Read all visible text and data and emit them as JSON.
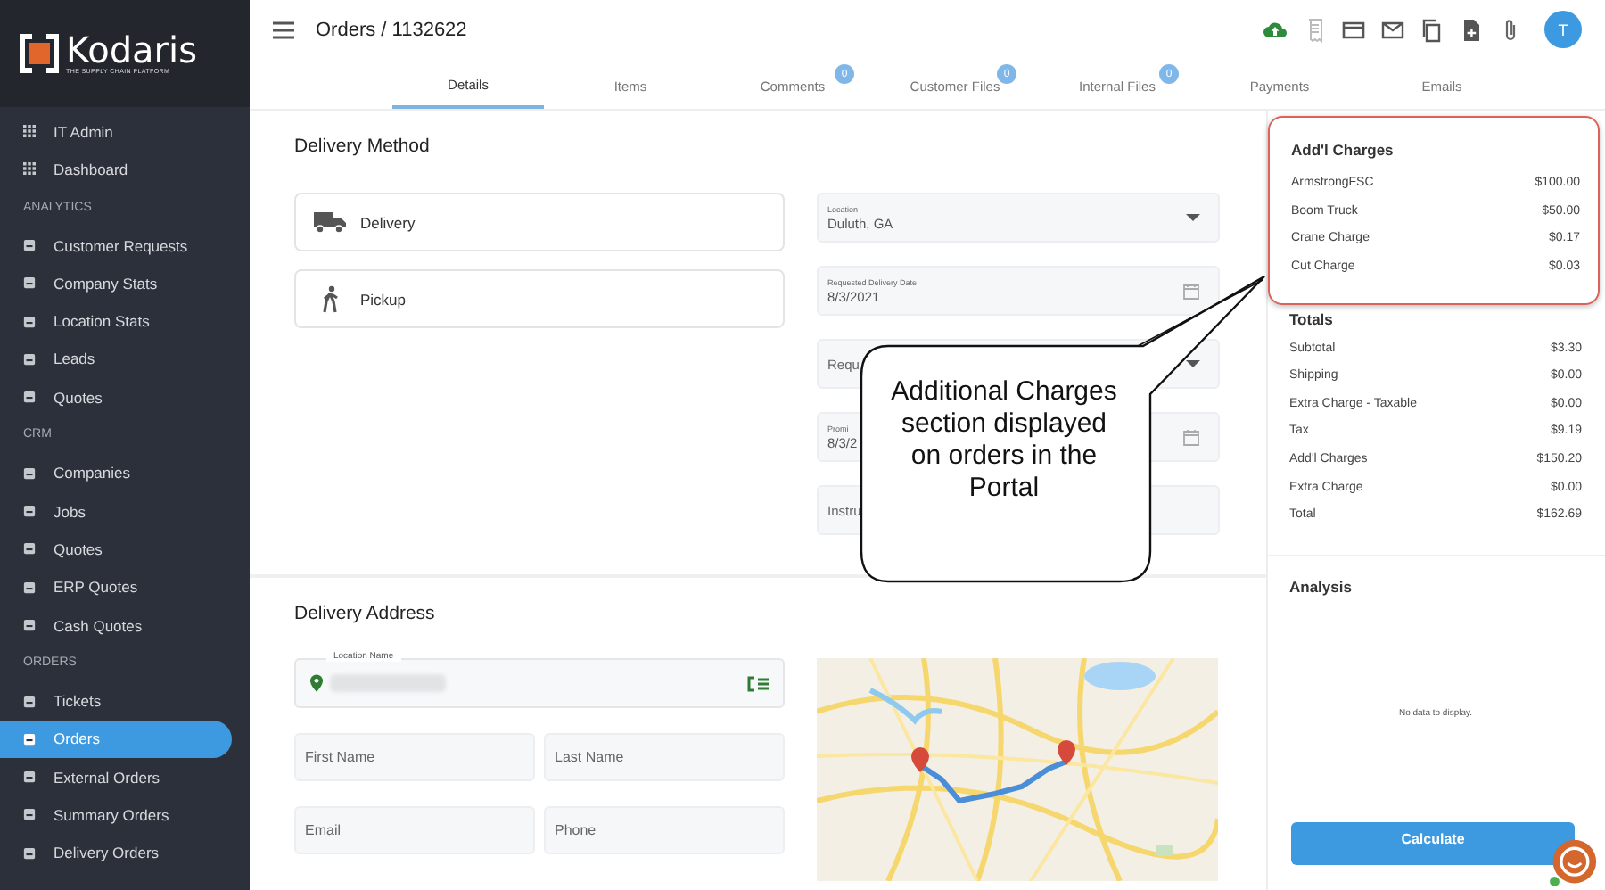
{
  "brand": {
    "name": "Kodaris",
    "tagline": "THE SUPPLY CHAIN PLATFORM"
  },
  "sidebar": {
    "items": [
      {
        "kind": "item",
        "label": "IT Admin",
        "selected": false
      },
      {
        "kind": "item",
        "label": "Dashboard",
        "selected": false
      },
      {
        "kind": "header",
        "label": "ANALYTICS"
      },
      {
        "kind": "item",
        "label": "Customer Requests",
        "selected": false
      },
      {
        "kind": "item",
        "label": "Company Stats",
        "selected": false
      },
      {
        "kind": "item",
        "label": "Location Stats",
        "selected": false
      },
      {
        "kind": "item",
        "label": "Leads",
        "selected": false
      },
      {
        "kind": "item",
        "label": "Quotes",
        "selected": false
      },
      {
        "kind": "header",
        "label": "CRM"
      },
      {
        "kind": "item",
        "label": "Companies",
        "selected": false
      },
      {
        "kind": "item",
        "label": "Jobs",
        "selected": false
      },
      {
        "kind": "item",
        "label": "Quotes",
        "selected": false
      },
      {
        "kind": "item",
        "label": "ERP Quotes",
        "selected": false
      },
      {
        "kind": "item",
        "label": "Cash Quotes",
        "selected": false
      },
      {
        "kind": "header",
        "label": "ORDERS"
      },
      {
        "kind": "item",
        "label": "Tickets",
        "selected": false
      },
      {
        "kind": "item",
        "label": "Orders",
        "selected": true
      },
      {
        "kind": "item",
        "label": "External Orders",
        "selected": false
      },
      {
        "kind": "item",
        "label": "Summary Orders",
        "selected": false
      },
      {
        "kind": "item",
        "label": "Delivery Orders",
        "selected": false
      }
    ]
  },
  "header": {
    "title": "Orders / 1132622",
    "avatar": "T"
  },
  "tabs": [
    {
      "label": "Details",
      "selected": true
    },
    {
      "label": "Items",
      "selected": false
    },
    {
      "label": "Comments",
      "badge": "0",
      "selected": false
    },
    {
      "label": "Customer Files",
      "badge": "0",
      "selected": false
    },
    {
      "label": "Internal Files",
      "badge": "0",
      "selected": false
    },
    {
      "label": "Payments",
      "selected": false
    },
    {
      "label": "Emails",
      "selected": false
    }
  ],
  "delivery_method": {
    "title": "Delivery Method",
    "options": [
      {
        "label": "Delivery"
      },
      {
        "label": "Pickup"
      }
    ],
    "fields": [
      {
        "kind": "select",
        "label": "Location",
        "value": "Duluth, GA"
      },
      {
        "kind": "date",
        "label": "Requested Delivery Date",
        "value": "8/3/2021"
      },
      {
        "kind": "select",
        "placeholder": "Requ"
      },
      {
        "kind": "date",
        "label": "Promi",
        "value": "8/3/2"
      },
      {
        "kind": "text",
        "placeholder": "Instru"
      }
    ]
  },
  "delivery_address": {
    "title": "Delivery Address",
    "location_label": "Location Name",
    "fields": [
      {
        "placeholder": "First Name"
      },
      {
        "placeholder": "Last Name"
      },
      {
        "placeholder": "Email"
      },
      {
        "placeholder": "Phone"
      }
    ]
  },
  "addl_charges": {
    "title": "Add'l Charges",
    "rows": [
      {
        "label": "ArmstrongFSC",
        "amount": "$100.00"
      },
      {
        "label": "Boom Truck",
        "amount": "$50.00"
      },
      {
        "label": "Crane Charge",
        "amount": "$0.17"
      },
      {
        "label": "Cut Charge",
        "amount": "$0.03"
      }
    ]
  },
  "totals": {
    "title": "Totals",
    "rows": [
      {
        "label": "Subtotal",
        "amount": "$3.30"
      },
      {
        "label": "Shipping",
        "amount": "$0.00"
      },
      {
        "label": "Extra Charge - Taxable",
        "amount": "$0.00"
      },
      {
        "label": "Tax",
        "amount": "$9.19"
      },
      {
        "label": "Add'l Charges",
        "amount": "$150.20"
      },
      {
        "label": "Extra Charge",
        "amount": "$0.00"
      },
      {
        "label": "Total",
        "amount": "$162.69"
      }
    ]
  },
  "analysis": {
    "title": "Analysis",
    "empty_text": "No data to display."
  },
  "calculate_button": "Calculate",
  "callout": {
    "text": "Additional Charges section displayed on orders in the Portal"
  }
}
